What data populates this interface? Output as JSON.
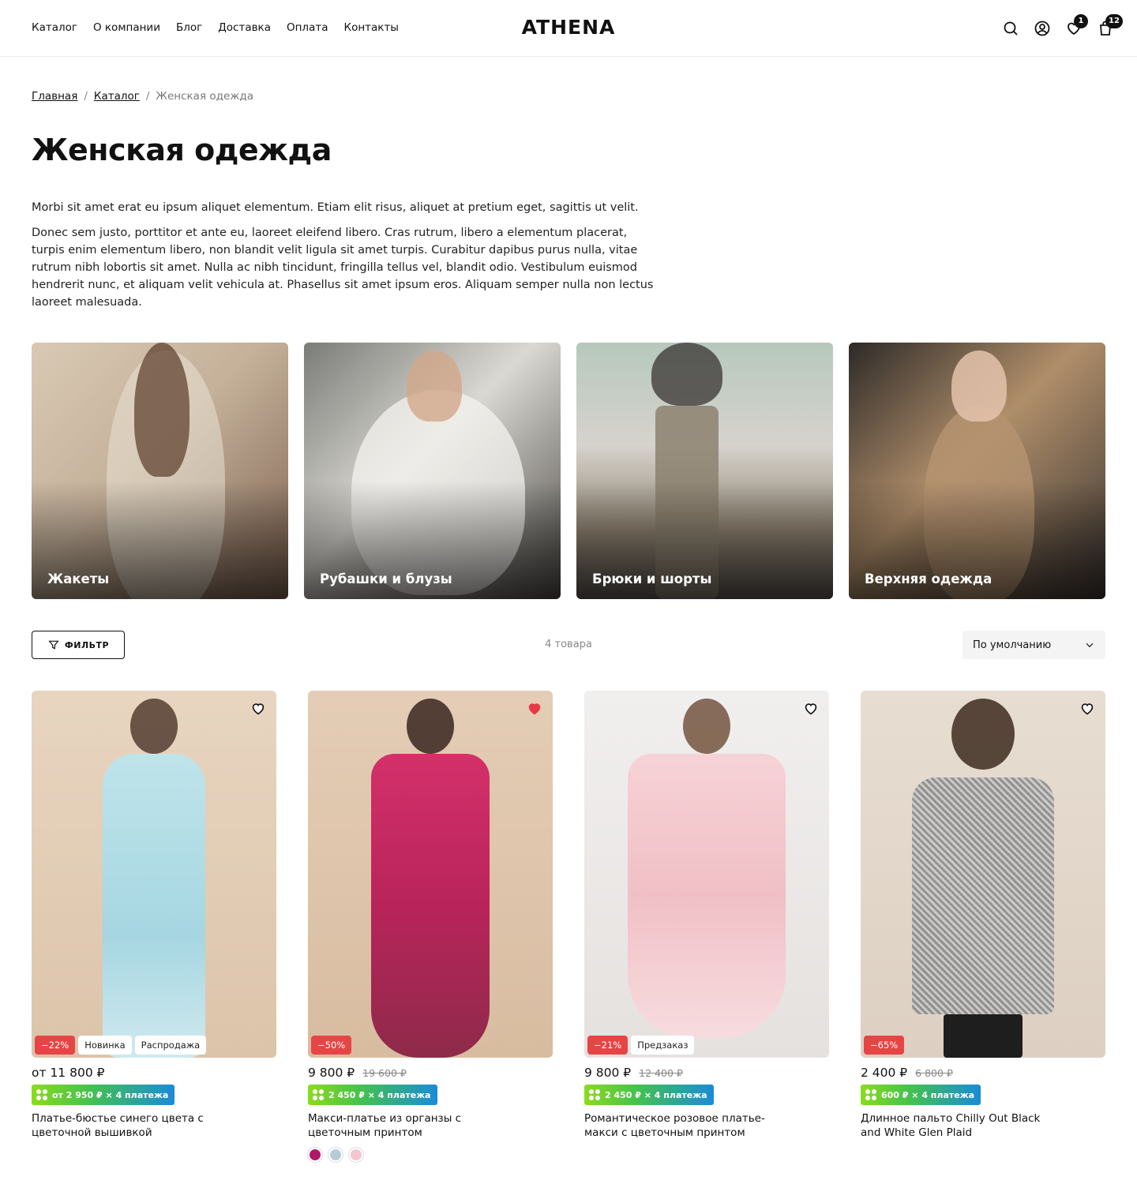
{
  "header": {
    "nav": [
      "Каталог",
      "О компании",
      "Блог",
      "Доставка",
      "Оплата",
      "Контакты"
    ],
    "logo": "ATHENA",
    "icons": [
      "search-icon",
      "user-icon",
      "heart-icon",
      "bag-icon"
    ],
    "wishlist_count": "1",
    "cart_count": "12"
  },
  "breadcrumb": {
    "home": "Главная",
    "catalog": "Каталог",
    "current": "Женская одежда",
    "separator": "/"
  },
  "page": {
    "title": "Женская одежда",
    "description": [
      "Morbi sit amet erat eu ipsum aliquet elementum. Etiam elit risus, aliquet at pretium eget, sagittis ut velit.",
      "Donec sem justo, porttitor et ante eu, laoreet eleifend libero. Cras rutrum, libero a elementum placerat, turpis enim elementum libero, non blandit velit ligula sit amet turpis. Curabitur dapibus purus nulla, vitae rutrum nibh lobortis sit amet. Nulla ac nibh tincidunt, fringilla tellus vel, blandit odio. Vestibulum euismod hendrerit nunc, et aliquam velit vehicula at. Phasellus sit amet ipsum eros. Aliquam semper nulla non lectus laoreet malesuada."
    ]
  },
  "categories": [
    {
      "label": "Жакеты"
    },
    {
      "label": "Рубашки и блузы"
    },
    {
      "label": "Брюки и шорты"
    },
    {
      "label": "Верхняя одежда"
    }
  ],
  "toolbar": {
    "filter_label": "ФИЛЬТР",
    "count": "4 товара",
    "sort_value": "По умолчанию"
  },
  "products": [
    {
      "price": "от 11 800 ₽",
      "old_price": "",
      "split": "от 2 950 ₽ × 4 платежа",
      "name": "Платье-бюстье синего цвета с цветочной вышивкой",
      "badges": [
        "−22%",
        "Новинка",
        "Распродажа"
      ],
      "favorited": false,
      "swatches": []
    },
    {
      "price": "9 800 ₽",
      "old_price": "19 600 ₽",
      "split": "2 450 ₽ × 4 платежа",
      "name": "Макси-платье из органзы с цветочным принтом",
      "badges": [
        "−50%"
      ],
      "favorited": true,
      "swatches": [
        "#b0176a",
        "#b7cbd6",
        "#f3c5d1"
      ]
    },
    {
      "price": "9 800 ₽",
      "old_price": "12 400 ₽",
      "split": "2 450 ₽ × 4 платежа",
      "name": "Романтическое розовое платье-макси с цветочным принтом",
      "badges": [
        "−21%",
        "Предзаказ"
      ],
      "favorited": false,
      "swatches": []
    },
    {
      "price": "2 400 ₽",
      "old_price": "6 800 ₽",
      "split": "600 ₽ × 4 платежа",
      "name": "Длинное пальто Chilly Out Black and White Glen Plaid",
      "badges": [
        "−65%"
      ],
      "favorited": false,
      "swatches": []
    }
  ],
  "colors": {
    "accent": "#111111",
    "sale": "#e64545",
    "favorite": "#e53945"
  }
}
